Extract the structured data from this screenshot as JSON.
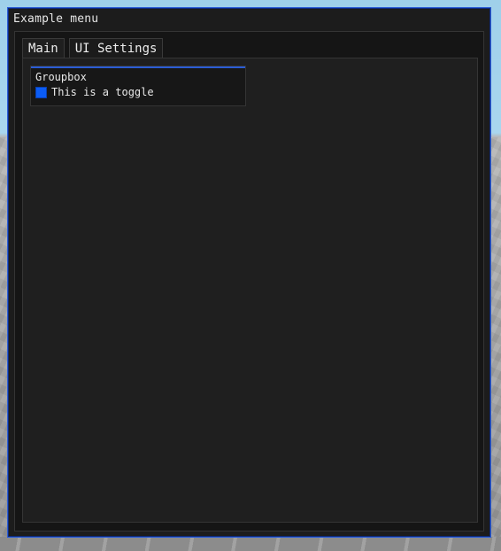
{
  "window": {
    "title": "Example menu",
    "accent_color": "#2b5dd6"
  },
  "tabs": [
    {
      "label": "Main",
      "active": true
    },
    {
      "label": "UI Settings",
      "active": false
    }
  ],
  "groupbox": {
    "title": "Groupbox",
    "toggle": {
      "label": "This is a toggle",
      "checked": true,
      "color": "#0b5cf5"
    }
  }
}
